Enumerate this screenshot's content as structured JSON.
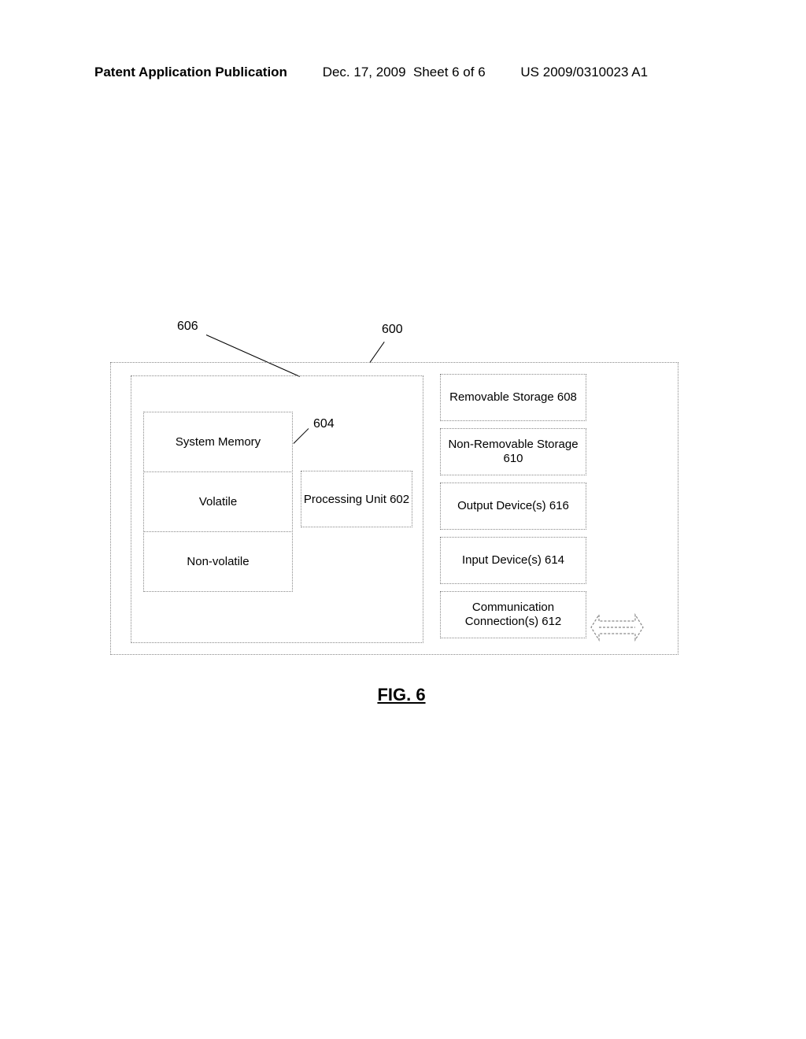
{
  "header": {
    "left": "Patent Application Publication",
    "mid": "Dec. 17, 2009  Sheet 6 of 6",
    "right": "US 2009/0310023 A1"
  },
  "refs": {
    "r600": "600",
    "r604": "604",
    "r606": "606"
  },
  "mem": {
    "sys": "System Memory",
    "vol": "Volatile",
    "nonvol": "Non-volatile"
  },
  "proc": "Processing Unit 602",
  "right": {
    "rem": "Removable Storage 608",
    "nonrem": "Non-Removable Storage 610",
    "out": "Output Device(s) 616",
    "in": "Input Device(s) 614",
    "comm": "Communication Connection(s) 612"
  },
  "figure": "FIG. 6"
}
